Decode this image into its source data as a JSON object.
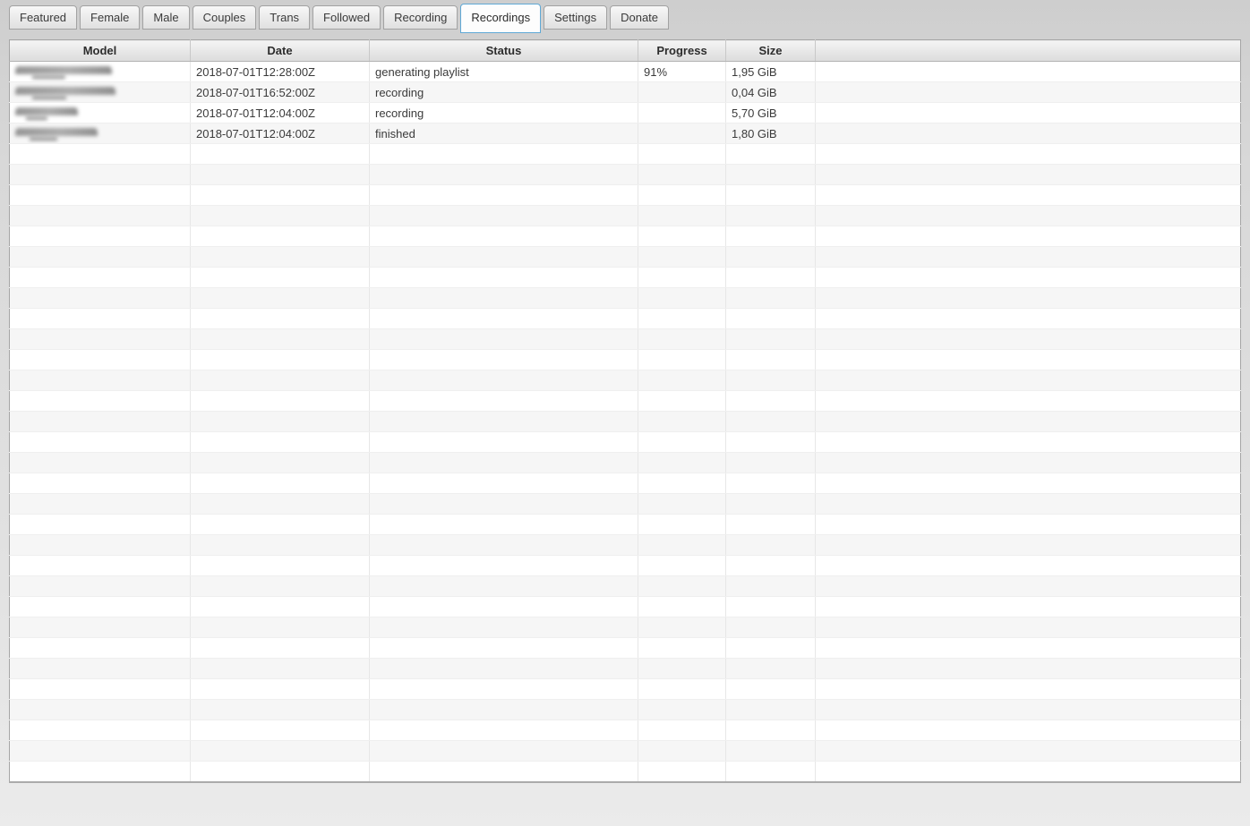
{
  "tabs": [
    {
      "label": "Featured",
      "active": false
    },
    {
      "label": "Female",
      "active": false
    },
    {
      "label": "Male",
      "active": false
    },
    {
      "label": "Couples",
      "active": false
    },
    {
      "label": "Trans",
      "active": false
    },
    {
      "label": "Followed",
      "active": false
    },
    {
      "label": "Recording",
      "active": false
    },
    {
      "label": "Recordings",
      "active": true
    },
    {
      "label": "Settings",
      "active": false
    },
    {
      "label": "Donate",
      "active": false
    }
  ],
  "table": {
    "columns": [
      "Model",
      "Date",
      "Status",
      "Progress",
      "Size"
    ],
    "rows": [
      {
        "model_redacted": true,
        "model_blur_width": 108,
        "date": "2018-07-01T12:28:00Z",
        "status": "generating playlist",
        "progress": "91%",
        "size": "1,95 GiB"
      },
      {
        "model_redacted": true,
        "model_blur_width": 112,
        "date": "2018-07-01T16:52:00Z",
        "status": "recording",
        "progress": "",
        "size": "0,04 GiB"
      },
      {
        "model_redacted": true,
        "model_blur_width": 70,
        "date": "2018-07-01T12:04:00Z",
        "status": "recording",
        "progress": "",
        "size": "5,70 GiB"
      },
      {
        "model_redacted": true,
        "model_blur_width": 92,
        "date": "2018-07-01T12:04:00Z",
        "status": "finished",
        "progress": "",
        "size": "1,80 GiB"
      }
    ],
    "empty_row_count": 31
  },
  "colors": {
    "active_tab_border": "#5fa8d5",
    "row_stripe": "#f6f6f6",
    "header_gradient_top": "#f4f4f4",
    "header_gradient_bottom": "#dcdcdc",
    "window_background": "#d8d8d8"
  }
}
